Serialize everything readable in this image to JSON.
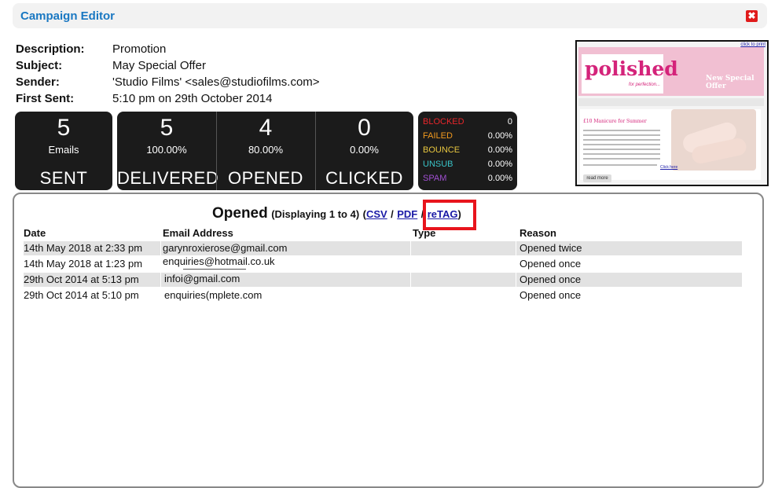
{
  "window": {
    "title": "Campaign Editor",
    "close_icon": "✖"
  },
  "campaign": {
    "rows": [
      {
        "label": "Description:",
        "value": "Promotion"
      },
      {
        "label": "Subject:",
        "value": "May Special Offer"
      },
      {
        "label": "Sender:",
        "value": "'Studio Films' <sales@studiofilms.com>"
      },
      {
        "label": "First Sent:",
        "value": "5:10 pm on 29th October 2014"
      }
    ]
  },
  "stats": {
    "sent": {
      "count": "5",
      "sub": "Emails",
      "caption": "SENT"
    },
    "delivered": {
      "count": "5",
      "sub": "100.00%",
      "caption": "DELIVERED"
    },
    "opened": {
      "count": "4",
      "sub": "80.00%",
      "caption": "OPENED"
    },
    "clicked": {
      "count": "0",
      "sub": "0.00%",
      "caption": "CLICKED"
    }
  },
  "issues": [
    {
      "label": "BLOCKED",
      "value": "0",
      "color": "#e8262b"
    },
    {
      "label": "FAILED",
      "value": "0.00%",
      "color": "#f39a1e"
    },
    {
      "label": "BOUNCE",
      "value": "0.00%",
      "color": "#e7c63f"
    },
    {
      "label": "UNSUB",
      "value": "0.00%",
      "color": "#39c3c7"
    },
    {
      "label": "SPAM",
      "value": "0.00%",
      "color": "#a04fd1"
    }
  ],
  "preview": {
    "link": "click to print",
    "logo": "polished",
    "logo_sub": "for perfection...",
    "headline": "New Special Offer",
    "content_title": "£10 Manicure for Summer",
    "click_here": "Click here",
    "read_more": "read more"
  },
  "panel": {
    "title": "Opened",
    "displaying": "(Displaying 1 to 4)",
    "open_paren": "(",
    "csv": "CSV",
    "sep1": "/",
    "pdf": "PDF",
    "sep2": "/",
    "retag": "reTAG",
    "close_paren": ")",
    "columns": [
      "Date",
      "Email Address",
      "Type",
      "Reason"
    ],
    "rows": [
      {
        "date": "14th May 2018 at 2:33 pm",
        "email": "garynroxierose@gmail.com",
        "type": "",
        "reason": "Opened twice"
      },
      {
        "date": "14th May 2018 at 1:23 pm",
        "email": "enquiries@hotmail.co.uk",
        "type": "",
        "reason": "Opened once"
      },
      {
        "date": "29th Oct 2014 at 5:13 pm",
        "email": "infoi@gmail.com",
        "type": "",
        "reason": "Opened once"
      },
      {
        "date": "29th Oct 2014 at 5:10 pm",
        "email": "enquiries(mplete.com",
        "type": "",
        "reason": "Opened once"
      }
    ]
  }
}
